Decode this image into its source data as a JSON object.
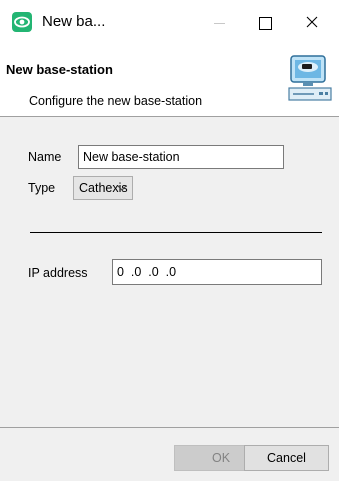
{
  "window": {
    "title": "New ba...",
    "accent_color": "#23b573"
  },
  "header": {
    "title": "New base-station",
    "subtitle": "Configure the new base-station",
    "icon": "base-station-computer-icon"
  },
  "form": {
    "name_label": "Name",
    "name_value": "New base-station",
    "type_label": "Type",
    "type_value": "Cathexis",
    "ip_label": "IP address",
    "ip_value": "0  .0  .0  .0"
  },
  "footer": {
    "ok_label": "OK",
    "cancel_label": "Cancel"
  }
}
